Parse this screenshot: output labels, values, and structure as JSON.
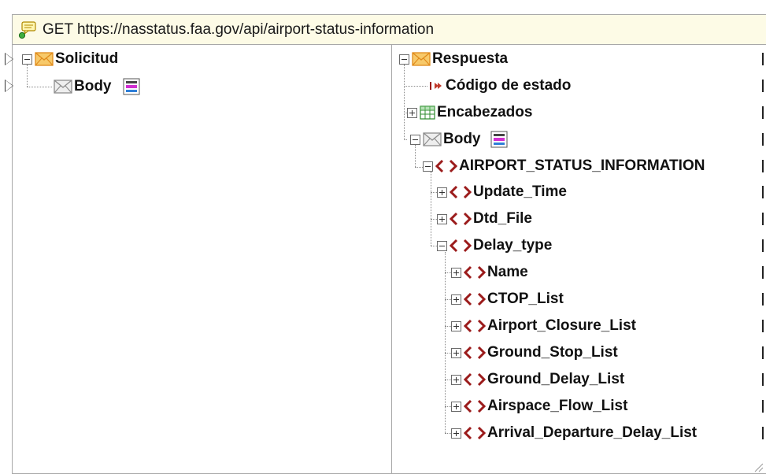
{
  "header": {
    "title": "GET https://nasstatus.faa.gov/api/airport-status-information",
    "icon": "api-call-icon"
  },
  "request": {
    "root_label": "Solicitud",
    "body_label": "Body"
  },
  "response": {
    "root_label": "Respuesta",
    "status_label": "Código de estado",
    "headers_label": "Encabezados",
    "body_label": "Body",
    "airport_label": "AIRPORT_STATUS_INFORMATION",
    "update_time_label": "Update_Time",
    "dtd_file_label": "Dtd_File",
    "delay_type_label": "Delay_type",
    "delay_children": [
      "Name",
      "CTOP_List",
      "Airport_Closure_List",
      "Ground_Stop_List",
      "Ground_Delay_List",
      "Airspace_Flow_List",
      "Arrival_Departure_Delay_List"
    ]
  },
  "colors": {
    "element_icon": "#9b1b1b",
    "envelope_fill": "#f7c96a",
    "envelope_stroke": "#e08a1a",
    "header_bg": "#fdfbe6"
  }
}
